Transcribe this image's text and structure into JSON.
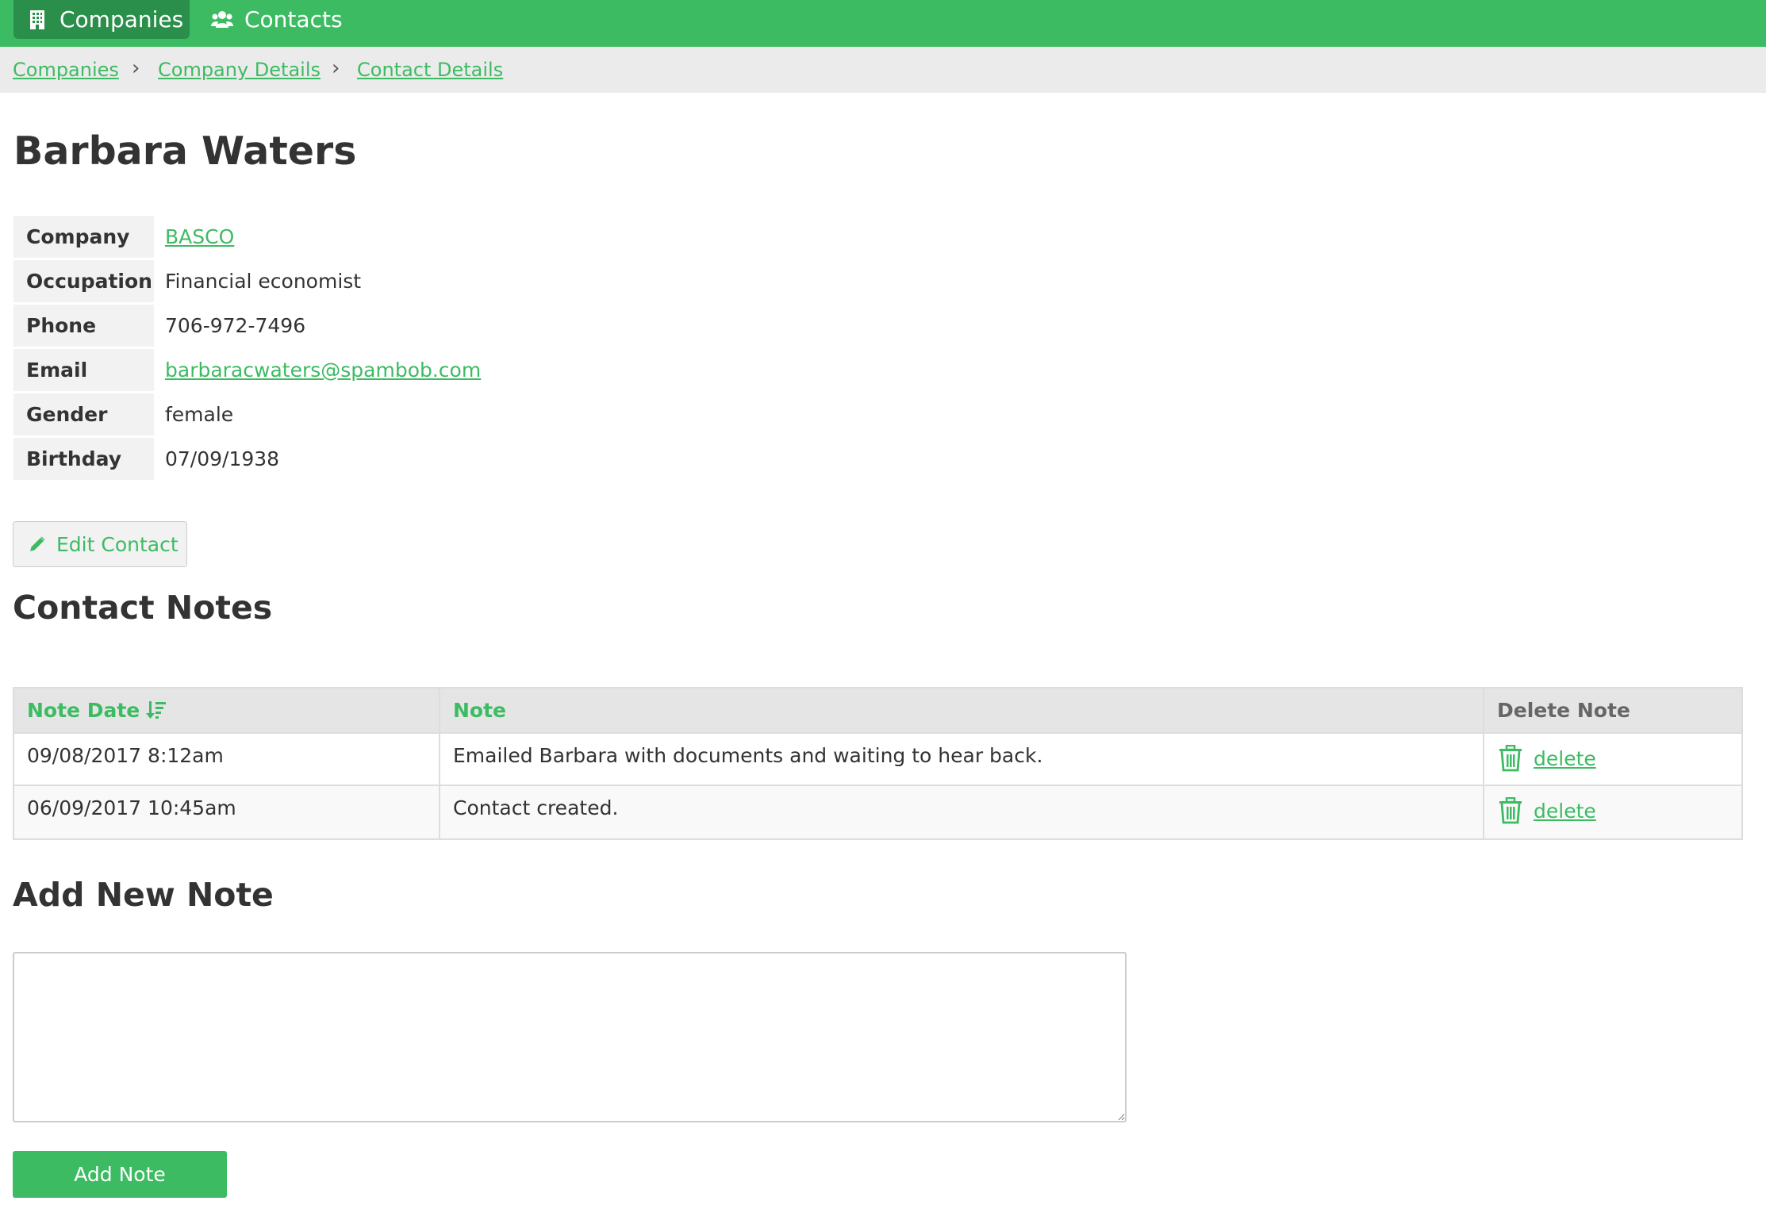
{
  "nav": {
    "tabs": [
      {
        "label": "Companies",
        "icon": "building-icon",
        "active": true
      },
      {
        "label": "Contacts",
        "icon": "users-icon",
        "active": false
      }
    ]
  },
  "breadcrumb": [
    "Companies",
    "Company Details",
    "Contact Details"
  ],
  "contact": {
    "name": "Barbara Waters",
    "fields": [
      {
        "label": "Company",
        "value": "BASCO",
        "link": true
      },
      {
        "label": "Occupation",
        "value": "Financial economist",
        "link": false
      },
      {
        "label": "Phone",
        "value": "706-972-7496",
        "link": false
      },
      {
        "label": "Email",
        "value": "barbaracwaters@spambob.com",
        "link": true
      },
      {
        "label": "Gender",
        "value": "female",
        "link": false
      },
      {
        "label": "Birthday",
        "value": "07/09/1938",
        "link": false
      }
    ]
  },
  "edit_button": {
    "label": "Edit Contact",
    "icon": "pencil-icon"
  },
  "notes": {
    "title": "Contact Notes",
    "columns": [
      "Note Date",
      "Note",
      "Delete Note"
    ],
    "sort_icon": "sort-descending-icon",
    "rows": [
      {
        "date": "09/08/2017 8:12am",
        "note": "Emailed Barbara with documents and waiting to hear back.",
        "action": "delete"
      },
      {
        "date": "06/09/2017 10:45am",
        "note": "Contact created.",
        "action": "delete"
      }
    ]
  },
  "add_note": {
    "title": "Add New Note",
    "textarea_value": "",
    "button_label": "Add Note"
  },
  "colors": {
    "accent": "#3dbb63",
    "nav_active": "#2a8f4a",
    "breadcrumb_bg": "#ebebeb"
  }
}
